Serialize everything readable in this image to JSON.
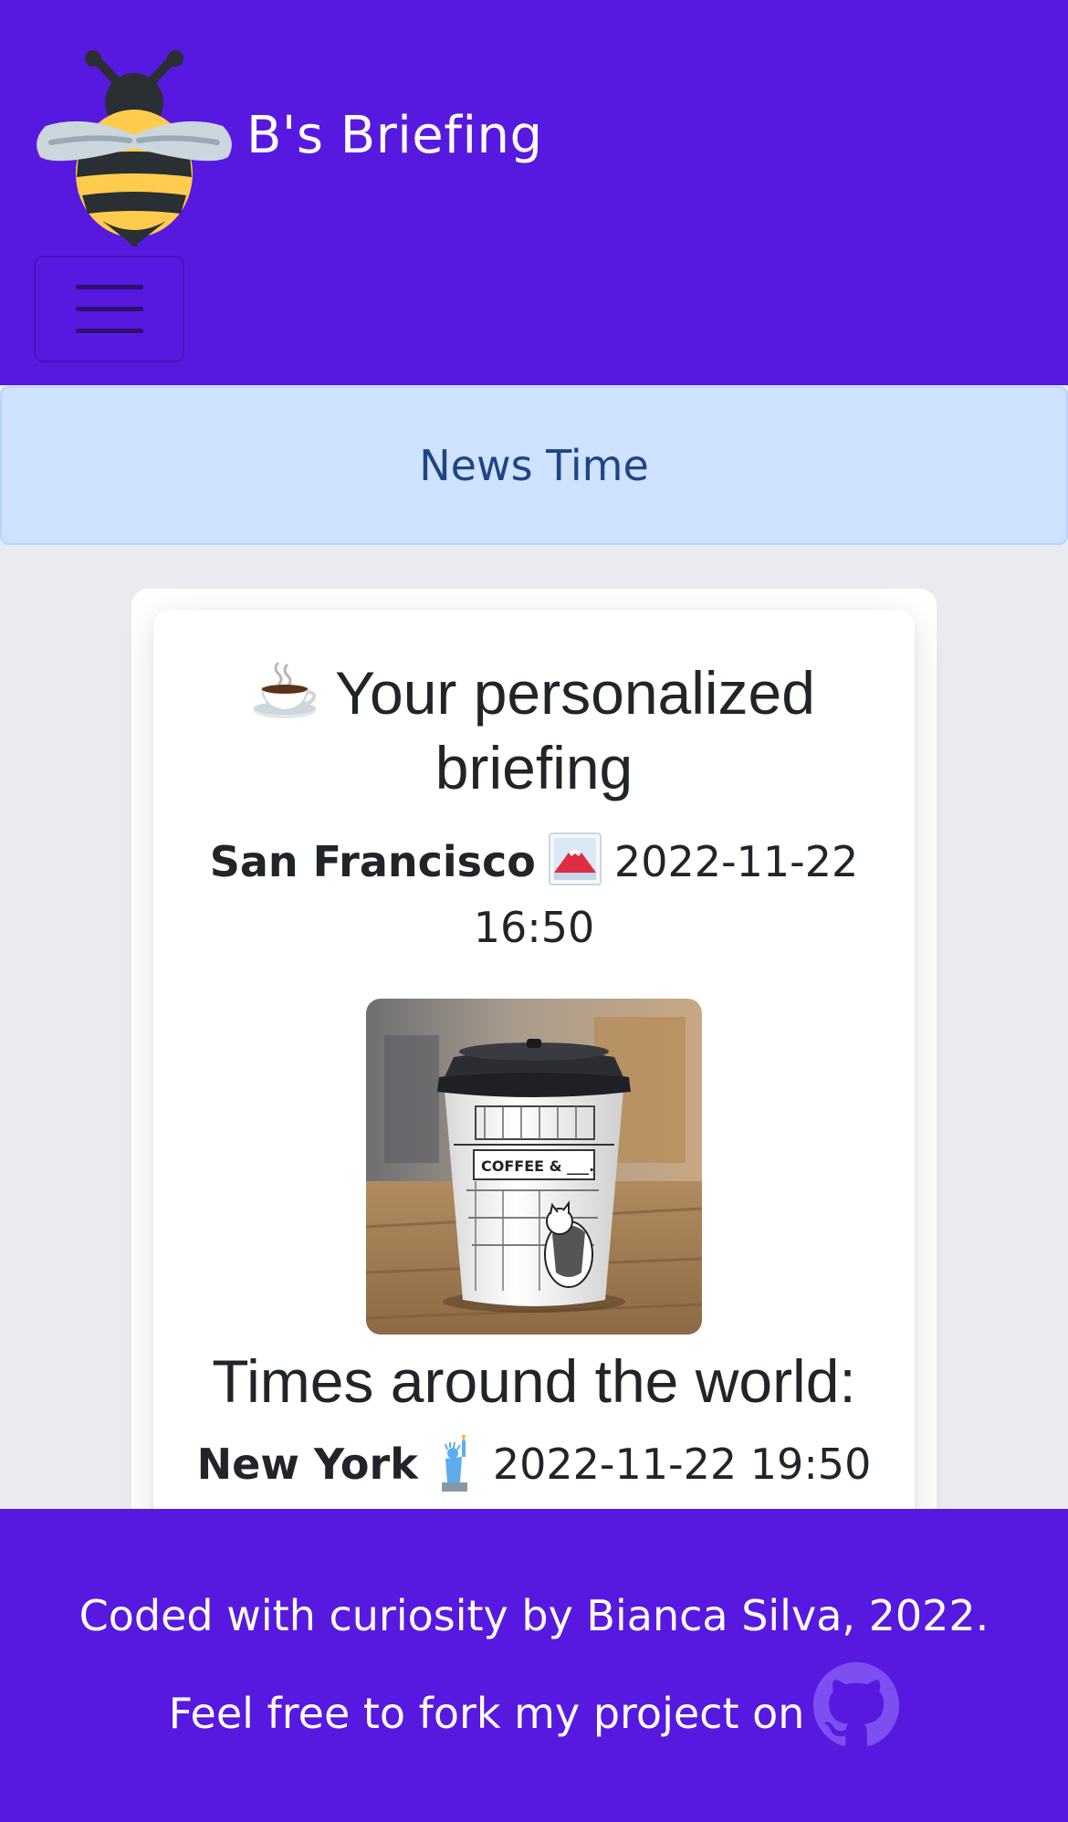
{
  "header": {
    "brand_name": "B's Briefing",
    "brand_logo_icon": "bee-icon",
    "menu_icon": "hamburger-menu-icon",
    "background_color": "#5719e0"
  },
  "alert": {
    "text": "News Time",
    "background_color": "#cfe2ff",
    "text_color": "#1e4584"
  },
  "briefing": {
    "title_icon": "hot-beverage-icon",
    "title": "Your personalized briefing",
    "local": {
      "city": "San Francisco",
      "icon": "mount-fuji-picture-icon",
      "datetime": "2022-11-22 16:50"
    },
    "photo_icon": "coffee-cup-photo",
    "world_heading": "Times around the world:",
    "world_times": [
      {
        "city": "New York",
        "icon": "statue-of-liberty-icon",
        "datetime": "2022-11-22 19:50"
      }
    ]
  },
  "footer": {
    "text": "Coded with curiosity by Bianca Silva, 2022. Feel free to fork my project on",
    "link_icon": "github-icon"
  }
}
